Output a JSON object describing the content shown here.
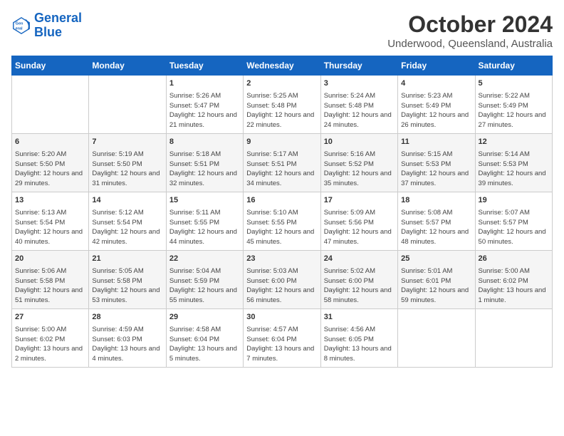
{
  "logo": {
    "line1": "General",
    "line2": "Blue"
  },
  "title": "October 2024",
  "location": "Underwood, Queensland, Australia",
  "weekdays": [
    "Sunday",
    "Monday",
    "Tuesday",
    "Wednesday",
    "Thursday",
    "Friday",
    "Saturday"
  ],
  "weeks": [
    [
      {
        "day": "",
        "info": ""
      },
      {
        "day": "",
        "info": ""
      },
      {
        "day": "1",
        "info": "Sunrise: 5:26 AM\nSunset: 5:47 PM\nDaylight: 12 hours and 21 minutes."
      },
      {
        "day": "2",
        "info": "Sunrise: 5:25 AM\nSunset: 5:48 PM\nDaylight: 12 hours and 22 minutes."
      },
      {
        "day": "3",
        "info": "Sunrise: 5:24 AM\nSunset: 5:48 PM\nDaylight: 12 hours and 24 minutes."
      },
      {
        "day": "4",
        "info": "Sunrise: 5:23 AM\nSunset: 5:49 PM\nDaylight: 12 hours and 26 minutes."
      },
      {
        "day": "5",
        "info": "Sunrise: 5:22 AM\nSunset: 5:49 PM\nDaylight: 12 hours and 27 minutes."
      }
    ],
    [
      {
        "day": "6",
        "info": "Sunrise: 5:20 AM\nSunset: 5:50 PM\nDaylight: 12 hours and 29 minutes."
      },
      {
        "day": "7",
        "info": "Sunrise: 5:19 AM\nSunset: 5:50 PM\nDaylight: 12 hours and 31 minutes."
      },
      {
        "day": "8",
        "info": "Sunrise: 5:18 AM\nSunset: 5:51 PM\nDaylight: 12 hours and 32 minutes."
      },
      {
        "day": "9",
        "info": "Sunrise: 5:17 AM\nSunset: 5:51 PM\nDaylight: 12 hours and 34 minutes."
      },
      {
        "day": "10",
        "info": "Sunrise: 5:16 AM\nSunset: 5:52 PM\nDaylight: 12 hours and 35 minutes."
      },
      {
        "day": "11",
        "info": "Sunrise: 5:15 AM\nSunset: 5:53 PM\nDaylight: 12 hours and 37 minutes."
      },
      {
        "day": "12",
        "info": "Sunrise: 5:14 AM\nSunset: 5:53 PM\nDaylight: 12 hours and 39 minutes."
      }
    ],
    [
      {
        "day": "13",
        "info": "Sunrise: 5:13 AM\nSunset: 5:54 PM\nDaylight: 12 hours and 40 minutes."
      },
      {
        "day": "14",
        "info": "Sunrise: 5:12 AM\nSunset: 5:54 PM\nDaylight: 12 hours and 42 minutes."
      },
      {
        "day": "15",
        "info": "Sunrise: 5:11 AM\nSunset: 5:55 PM\nDaylight: 12 hours and 44 minutes."
      },
      {
        "day": "16",
        "info": "Sunrise: 5:10 AM\nSunset: 5:55 PM\nDaylight: 12 hours and 45 minutes."
      },
      {
        "day": "17",
        "info": "Sunrise: 5:09 AM\nSunset: 5:56 PM\nDaylight: 12 hours and 47 minutes."
      },
      {
        "day": "18",
        "info": "Sunrise: 5:08 AM\nSunset: 5:57 PM\nDaylight: 12 hours and 48 minutes."
      },
      {
        "day": "19",
        "info": "Sunrise: 5:07 AM\nSunset: 5:57 PM\nDaylight: 12 hours and 50 minutes."
      }
    ],
    [
      {
        "day": "20",
        "info": "Sunrise: 5:06 AM\nSunset: 5:58 PM\nDaylight: 12 hours and 51 minutes."
      },
      {
        "day": "21",
        "info": "Sunrise: 5:05 AM\nSunset: 5:58 PM\nDaylight: 12 hours and 53 minutes."
      },
      {
        "day": "22",
        "info": "Sunrise: 5:04 AM\nSunset: 5:59 PM\nDaylight: 12 hours and 55 minutes."
      },
      {
        "day": "23",
        "info": "Sunrise: 5:03 AM\nSunset: 6:00 PM\nDaylight: 12 hours and 56 minutes."
      },
      {
        "day": "24",
        "info": "Sunrise: 5:02 AM\nSunset: 6:00 PM\nDaylight: 12 hours and 58 minutes."
      },
      {
        "day": "25",
        "info": "Sunrise: 5:01 AM\nSunset: 6:01 PM\nDaylight: 12 hours and 59 minutes."
      },
      {
        "day": "26",
        "info": "Sunrise: 5:00 AM\nSunset: 6:02 PM\nDaylight: 13 hours and 1 minute."
      }
    ],
    [
      {
        "day": "27",
        "info": "Sunrise: 5:00 AM\nSunset: 6:02 PM\nDaylight: 13 hours and 2 minutes."
      },
      {
        "day": "28",
        "info": "Sunrise: 4:59 AM\nSunset: 6:03 PM\nDaylight: 13 hours and 4 minutes."
      },
      {
        "day": "29",
        "info": "Sunrise: 4:58 AM\nSunset: 6:04 PM\nDaylight: 13 hours and 5 minutes."
      },
      {
        "day": "30",
        "info": "Sunrise: 4:57 AM\nSunset: 6:04 PM\nDaylight: 13 hours and 7 minutes."
      },
      {
        "day": "31",
        "info": "Sunrise: 4:56 AM\nSunset: 6:05 PM\nDaylight: 13 hours and 8 minutes."
      },
      {
        "day": "",
        "info": ""
      },
      {
        "day": "",
        "info": ""
      }
    ]
  ]
}
